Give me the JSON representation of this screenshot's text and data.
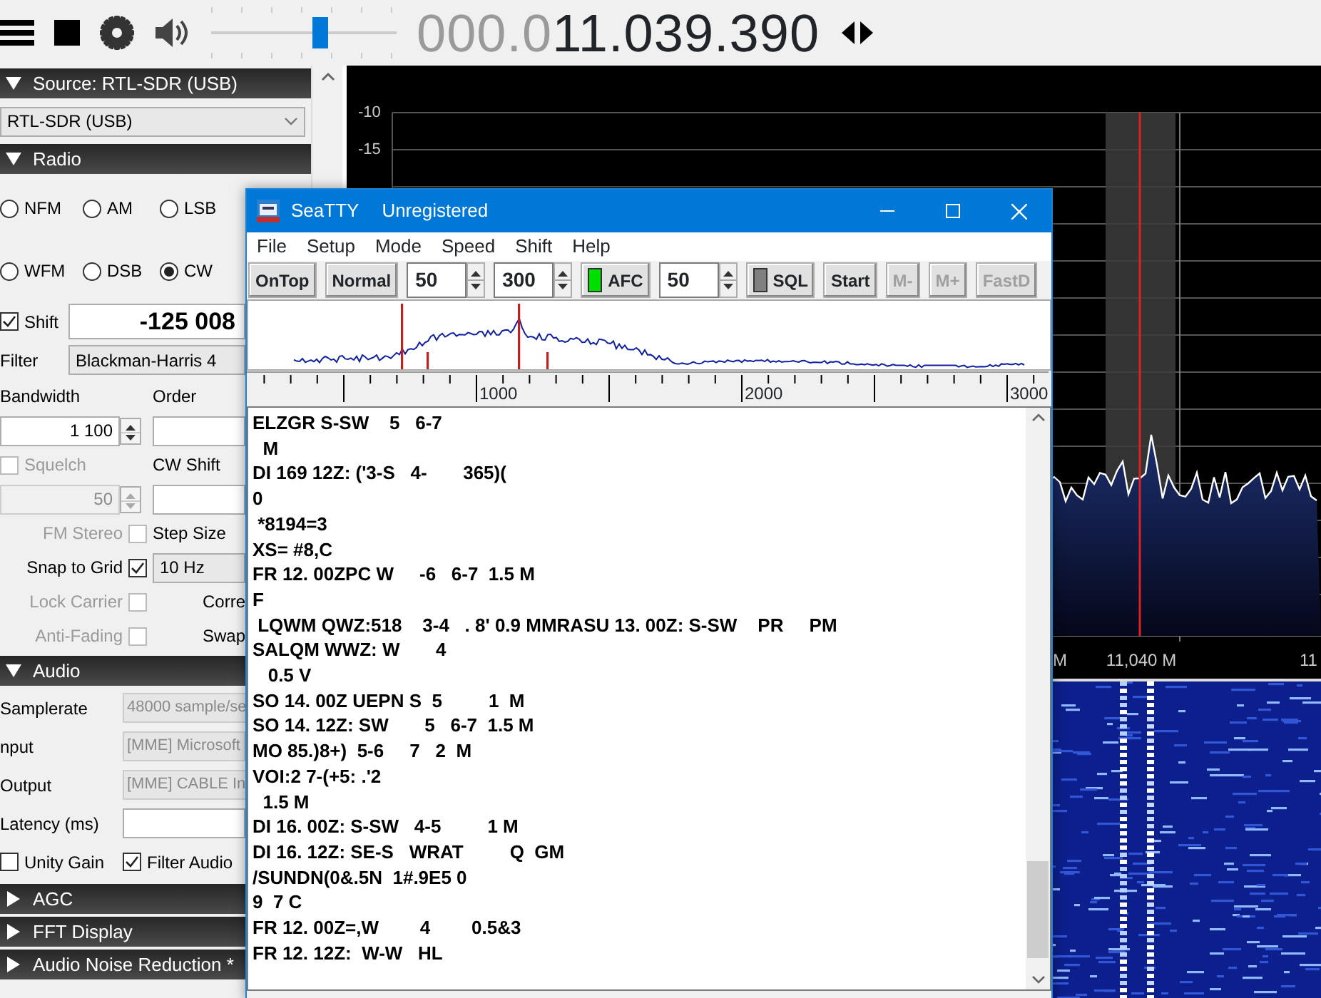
{
  "toolbar": {
    "volume": {
      "level": 0.6
    },
    "frequency_dim": "000.0",
    "frequency": "11.039.390"
  },
  "left_panel": {
    "sections": [
      {
        "title": "Source: RTL-SDR (USB)",
        "expanded": true,
        "rows": [
          {
            "kind": "full",
            "cells": [
              {
                "kind": "select",
                "value": "RTL-SDR (USB)",
                "disabled": false
              }
            ]
          }
        ]
      },
      {
        "title": "Radio",
        "expanded": true,
        "rows": [
          {
            "kind": "radio3",
            "cells": [
              {
                "kind": "radio",
                "label": "NFM",
                "selected": false
              },
              {
                "kind": "radio",
                "label": "AM",
                "selected": false
              },
              {
                "kind": "radio",
                "label": "LSB",
                "selected": false
              }
            ]
          },
          {
            "kind": "radio3",
            "cells": [
              {
                "kind": "radio",
                "label": "WFM",
                "selected": false
              },
              {
                "kind": "radio",
                "label": "DSB",
                "selected": false
              },
              {
                "kind": "radio",
                "label": "CW",
                "selected": true
              }
            ]
          },
          {
            "kind": "wide",
            "cells": [
              {
                "kind": "check",
                "label": "Shift",
                "checked": true,
                "disabled": false
              },
              {
                "kind": "bigfield",
                "value": "-125 008"
              }
            ]
          },
          {
            "kind": "wide",
            "cells": [
              {
                "kind": "label",
                "label": "Filter",
                "disabled": false
              },
              {
                "kind": "select",
                "value": "Blackman-Harris 4",
                "disabled": false
              }
            ]
          },
          {
            "kind": "pair",
            "cells": [
              {
                "kind": "label",
                "label": "Bandwidth",
                "disabled": false
              },
              {
                "kind": "label",
                "label": "Order",
                "disabled": false
              }
            ]
          },
          {
            "kind": "pair",
            "cells": [
              {
                "kind": "spin",
                "value": "1 100",
                "disabled": false
              },
              {
                "kind": "field"
              }
            ]
          },
          {
            "kind": "pair",
            "cells": [
              {
                "kind": "check",
                "label": "Squelch",
                "checked": false,
                "disabled": true
              },
              {
                "kind": "label",
                "label": "CW Shift",
                "disabled": false
              }
            ]
          },
          {
            "kind": "pair",
            "cells": [
              {
                "kind": "spin",
                "value": "50",
                "disabled": true
              },
              {
                "kind": "field"
              }
            ]
          },
          {
            "kind": "pair",
            "cells": [
              {
                "kind": "rcheck",
                "label": "FM Stereo",
                "checked": false,
                "disabled": true
              },
              {
                "kind": "label",
                "label": "Step Size",
                "disabled": false
              }
            ]
          },
          {
            "kind": "pair",
            "cells": [
              {
                "kind": "rcheck",
                "label": "Snap to Grid",
                "checked": true,
                "disabled": false
              },
              {
                "kind": "select",
                "value": "10 Hz",
                "disabled": false
              }
            ]
          },
          {
            "kind": "pair",
            "cells": [
              {
                "kind": "rcheck",
                "label": "Lock Carrier",
                "checked": false,
                "disabled": true
              },
              {
                "kind": "rlabel",
                "label": "Corre",
                "disabled": false
              }
            ]
          },
          {
            "kind": "pair",
            "cells": [
              {
                "kind": "rcheck",
                "label": "Anti-Fading",
                "checked": false,
                "disabled": true
              },
              {
                "kind": "rlabel",
                "label": "Swap",
                "disabled": false
              }
            ]
          }
        ]
      },
      {
        "title": "Audio",
        "expanded": true,
        "rows": [
          {
            "kind": "audio",
            "cells": [
              {
                "kind": "label",
                "label": "Samplerate",
                "disabled": false
              },
              {
                "kind": "select",
                "value": "48000 sample/se",
                "disabled": true
              }
            ]
          },
          {
            "kind": "audio",
            "cells": [
              {
                "kind": "label",
                "label": "nput",
                "disabled": false
              },
              {
                "kind": "select",
                "value": "[MME] Microsoft",
                "disabled": true
              }
            ]
          },
          {
            "kind": "audio",
            "cells": [
              {
                "kind": "label",
                "label": "Output",
                "disabled": false
              },
              {
                "kind": "select",
                "value": "[MME] CABLE In",
                "disabled": true
              }
            ]
          },
          {
            "kind": "audio",
            "cells": [
              {
                "kind": "label",
                "label": "Latency (ms)",
                "disabled": false
              },
              {
                "kind": "field"
              }
            ]
          },
          {
            "kind": "audio",
            "cells": [
              {
                "kind": "check",
                "label": "Unity Gain",
                "checked": false,
                "disabled": false
              },
              {
                "kind": "check",
                "label": "Filter Audio",
                "checked": true,
                "disabled": false
              }
            ]
          }
        ]
      },
      {
        "title": "AGC",
        "expanded": false
      },
      {
        "title": "FFT Display",
        "expanded": false
      },
      {
        "title": "Audio Noise Reduction *",
        "expanded": false
      }
    ]
  },
  "spectrum": {
    "y_labels": [
      "-10",
      "-15"
    ],
    "x_labels": [
      "M",
      "11,040 M",
      "11"
    ]
  },
  "seatty": {
    "title": "SeaTTY",
    "subtitle": "Unregistered",
    "menu": [
      "File",
      "Setup",
      "Mode",
      "Speed",
      "Shift",
      "Help"
    ],
    "controls": [
      {
        "kind": "button",
        "label": "OnTop",
        "disabled": false
      },
      {
        "kind": "button",
        "label": "Normal",
        "disabled": false
      },
      {
        "kind": "spin",
        "value": "50"
      },
      {
        "kind": "spin",
        "value": "300"
      },
      {
        "kind": "indicator",
        "label": "AFC",
        "on": true
      },
      {
        "kind": "spin",
        "value": "50"
      },
      {
        "kind": "indicator",
        "label": "SQL",
        "on": false
      },
      {
        "kind": "button",
        "label": "Start",
        "disabled": false
      },
      {
        "kind": "button",
        "label": "M-",
        "disabled": true
      },
      {
        "kind": "button",
        "label": "M+",
        "disabled": true
      },
      {
        "kind": "button",
        "label": "FastD",
        "disabled": true
      }
    ],
    "scale_labels": [
      "1000",
      "2000",
      "3000"
    ],
    "lines": [
      "ELZGR S-SW    5   6-7",
      "  M",
      "DI 169 12Z: ('3-S   4-       365)(",
      "0",
      " *8194=3",
      "XS= #8,C",
      "FR 12. 00ZPC W     -6   6-7  1.5 M",
      "F",
      " LQWM QWZ:518    3-4   . 8' 0.9 MMRASU 13. 00Z: S-SW    PR     PM",
      "SALQM WWZ: W       4",
      "   0.5 V",
      "SO 14. 00Z UEPN S  5         1  M",
      "SO 14. 12Z: SW       5   6-7  1.5 M",
      "MO 85.)8+)  5-6     7   2  M",
      "VOI:2 7-(+5: .'2",
      "  1.5 M",
      "DI 16. 00Z: S-SW   4-5         1 M",
      "DI 16. 12Z: SE-S   WRAT         Q  GM",
      "/SUNDN(0&.5N  1#.9E5 0",
      "9  7 C",
      "FR 12. 00Z=,W        4        0.5&3",
      "FR 12. 12Z:  W-W   HL"
    ]
  }
}
